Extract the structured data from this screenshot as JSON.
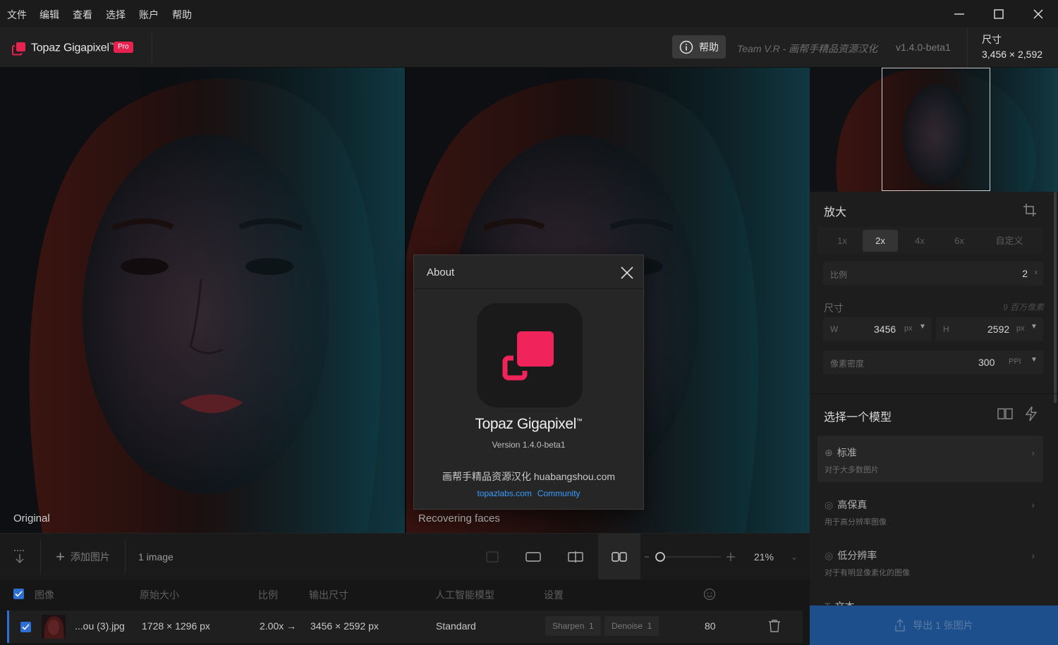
{
  "menu": [
    "文件",
    "编辑",
    "查看",
    "选择",
    "账户",
    "帮助"
  ],
  "app": {
    "name": "Topaz Gigapixel",
    "tm": "™",
    "badge": "Pro",
    "help_label": "帮助",
    "team": "Team V.R - 画帮手精品资源汉化",
    "version": "v1.4.0-beta1",
    "size_label": "尺寸",
    "size_value": "3,456 × 2,592"
  },
  "preview": {
    "left_label": "Original",
    "right_label": "Recovering faces"
  },
  "about": {
    "title": "About",
    "product": "Topaz Gigapixel",
    "tm": "™",
    "version": "Version 1.4.0-beta1",
    "credit": "画帮手精品资源汉化 huabangshou.com",
    "link1": "topazlabs.com",
    "link2": "Community"
  },
  "panel": {
    "enlarge_title": "放大",
    "scales": [
      "1x",
      "2x",
      "4x",
      "6x",
      "自定义"
    ],
    "selected_scale": "2x",
    "ratio_label": "比例",
    "ratio_value": "2",
    "ratio_unit": "x",
    "dim_label": "尺寸",
    "dim_hint": "9 百万像素",
    "w_label": "W",
    "w_value": "3456",
    "w_unit": "px",
    "h_label": "H",
    "h_value": "2592",
    "h_unit": "px",
    "density_label": "像素密度",
    "density_value": "300",
    "density_unit": "PPI",
    "model_title": "选择一个模型",
    "models": [
      {
        "name": "标准",
        "desc": "对于大多数图片"
      },
      {
        "name": "高保真",
        "desc": "用于高分辨率图像"
      },
      {
        "name": "低分辨率",
        "desc": "对于有明显像素化的图像"
      },
      {
        "name": "文本",
        "desc": ""
      }
    ],
    "export_label": "导出 1 张图片"
  },
  "toolbar": {
    "add_label": "添加图片",
    "count": "1 image",
    "zoom": "21%"
  },
  "filelist": {
    "headers": [
      "图像",
      "原始大小",
      "比例",
      "输出尺寸",
      "人工智能模型",
      "设置"
    ],
    "row": {
      "name": "...ou (3).jpg",
      "orig": "1728 × 1296 px",
      "scale": "2.00x →",
      "out": "3456 × 2592 px",
      "model": "Standard",
      "sharpen": "Sharpen",
      "sharpen_val": "1",
      "denoise": "Denoise",
      "denoise_val": "1",
      "face": "80"
    }
  },
  "colors": {
    "accent_red": "#e8224f",
    "accent_blue": "#2d6fd6",
    "export_bg": "#1c4f8c"
  }
}
